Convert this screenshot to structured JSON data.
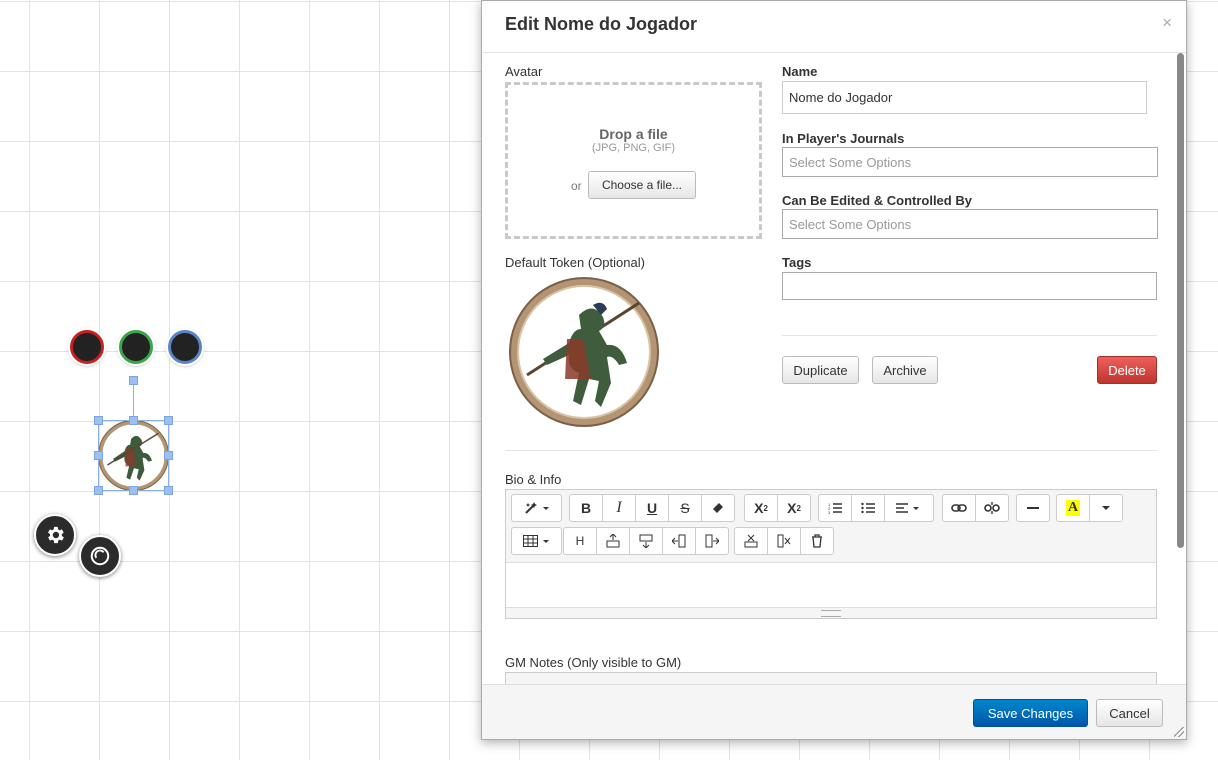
{
  "dialog": {
    "title": "Edit Nome do Jogador",
    "close_glyph": "×"
  },
  "avatar": {
    "label": "Avatar",
    "drop_title": "Drop a file",
    "drop_formats": "(JPG, PNG, GIF)",
    "or_text": "or",
    "choose_button": "Choose a file..."
  },
  "token": {
    "label": "Default Token (Optional)"
  },
  "fields": {
    "name_label": "Name",
    "name_value": "Nome do Jogador",
    "journals_label": "In Player's Journals",
    "journals_placeholder": "Select Some Options",
    "controlled_label": "Can Be Edited & Controlled By",
    "controlled_placeholder": "Select Some Options",
    "tags_label": "Tags",
    "tags_value": ""
  },
  "actions": {
    "duplicate": "Duplicate",
    "archive": "Archive",
    "delete": "Delete"
  },
  "bio": {
    "label": "Bio & Info",
    "toolbar_row1": [
      "magic-wand",
      "bold",
      "italic",
      "underline",
      "strikethrough",
      "eraser",
      "superscript",
      "subscript",
      "ordered-list",
      "unordered-list",
      "align",
      "link",
      "unlink",
      "horizontal-rule",
      "highlight",
      "highlight-dropdown"
    ],
    "toolbar_row2": [
      "table",
      "heading",
      "insert-row-above",
      "insert-row-below",
      "insert-col-left",
      "insert-col-right",
      "delete-row",
      "delete-col",
      "delete-table"
    ]
  },
  "gm_notes": {
    "label": "GM Notes (Only visible to GM)"
  },
  "footer": {
    "save": "Save Changes",
    "cancel": "Cancel"
  },
  "canvas": {
    "status_colors": [
      "#c82020",
      "#3aa64a",
      "#5a84c8"
    ],
    "tools": [
      "gear-icon",
      "aura-icon"
    ]
  },
  "colors": {
    "primary": "#0066bb",
    "danger": "#d33d36",
    "grid": "#e3e3e3"
  }
}
